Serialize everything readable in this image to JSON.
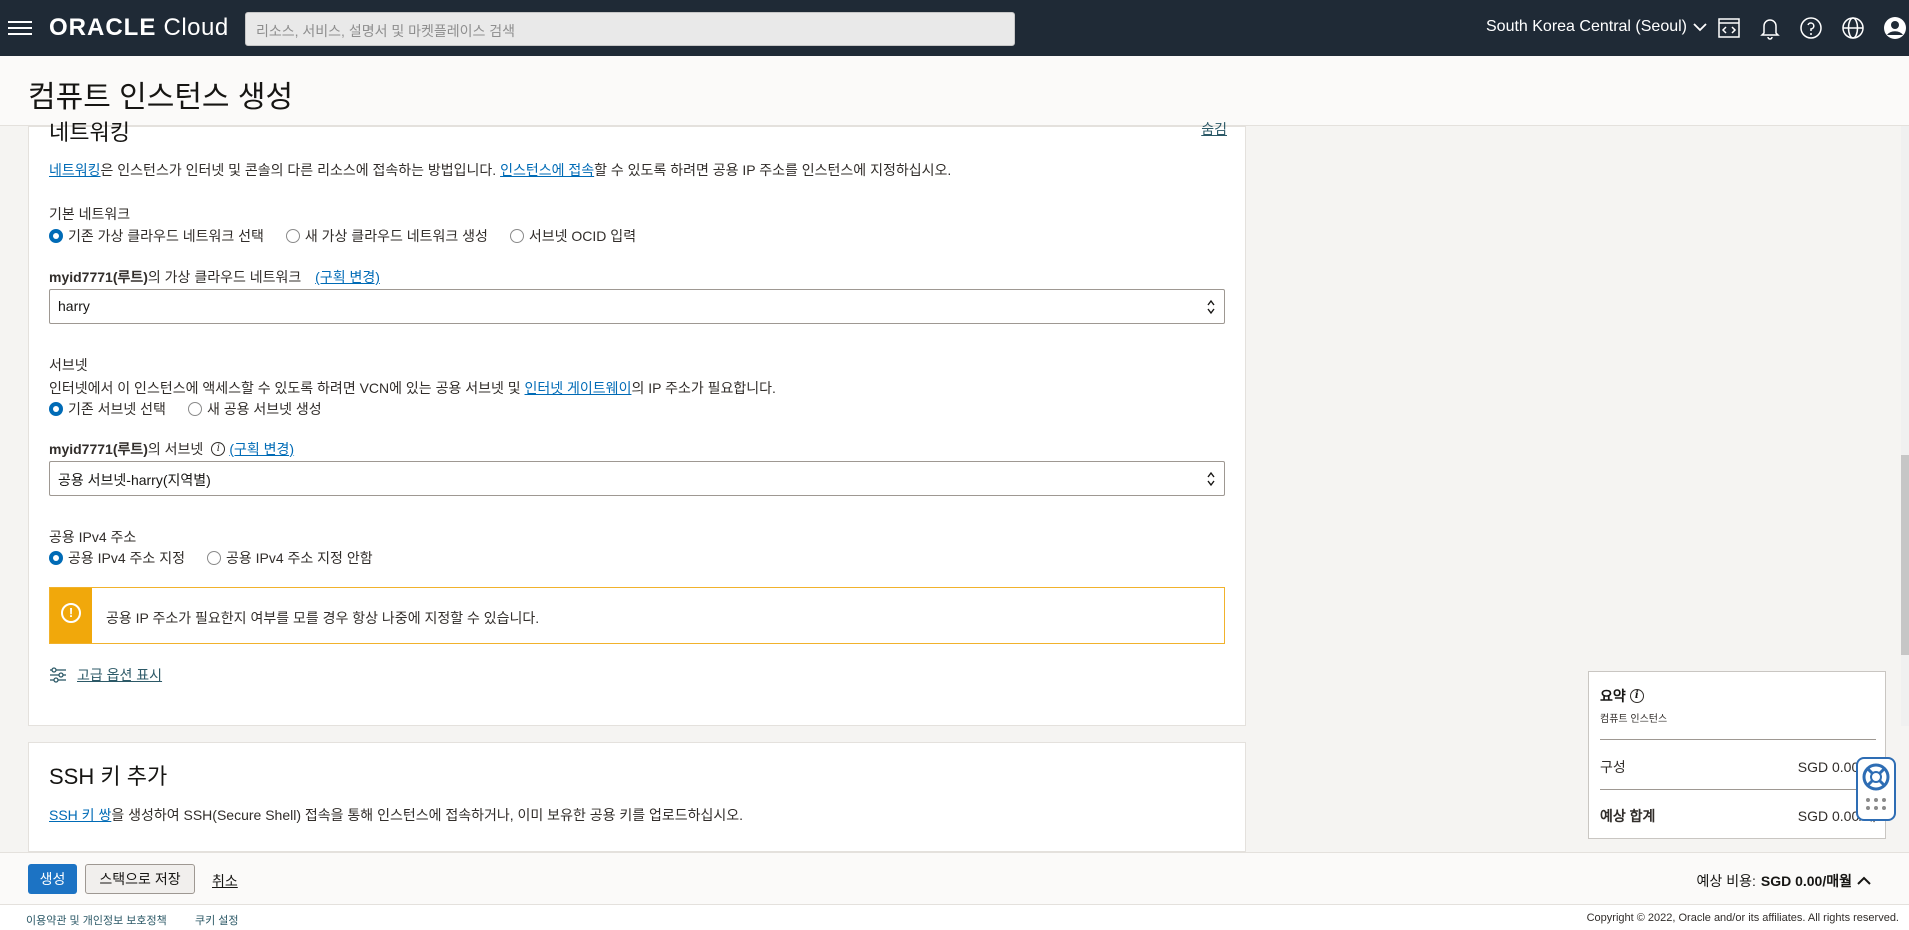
{
  "topbar": {
    "logo_brand": "ORACLE",
    "logo_product": " Cloud",
    "search_placeholder": "리소스, 서비스, 설명서 및 마켓플레이스 검색",
    "region": "South Korea Central (Seoul)",
    "icons": [
      "menu-icon",
      "code-editor-icon",
      "bell-icon",
      "help-icon",
      "globe-icon",
      "user-icon"
    ]
  },
  "page": {
    "title": "컴퓨트 인스턴스 생성"
  },
  "networking": {
    "title": "네트워킹",
    "help_link": "숨김",
    "desc_link1": "네트워킹",
    "desc_part1": "은 인스턴스가 인터넷 및 콘솔의 다른 리소스에 접속하는 방법입니다. ",
    "desc_link2": "인스턴스에 접속",
    "desc_part2": "할 수 있도록 하려면 공용 IP 주소를 인스턴스에 지정하십시오.",
    "primary_network_label": "기본 네트워크",
    "network_options": [
      "기존 가상 클라우드 네트워크 선택",
      "새 가상 클라우드 네트워크 생성",
      "서브넷 OCID 입력"
    ],
    "vcn_compartment": "myid7771(루트)",
    "vcn_label_suffix": "의 가상 클라우드 네트워크",
    "change_compartment": "(구획 변경)",
    "vcn_value": "harry",
    "subnet_label": "서브넷",
    "subnet_desc_part1": "인터넷에서 이 인스턴스에 액세스할 수 있도록 하려면 VCN에 있는 공용 서브넷 및 ",
    "subnet_desc_link": "인터넷 게이트웨이",
    "subnet_desc_part2": "의 IP 주소가 필요합니다.",
    "subnet_options": [
      "기존 서브넷 선택",
      "새 공용 서브넷 생성"
    ],
    "subnet_compartment": "myid7771(루트)",
    "subnet_label_suffix": "의 서브넷",
    "subnet_value": "공용 서브넷-harry(지역별)",
    "ipv4_label": "공용 IPv4 주소",
    "ipv4_options": [
      "공용 IPv4 주소 지정",
      "공용 IPv4 주소 지정 안함"
    ],
    "warning": "공용 IP 주소가 필요한지 여부를 모를 경우 항상 나중에 지정할 수 있습니다.",
    "advanced": "고급 옵션 표시"
  },
  "ssh": {
    "title": "SSH 키 추가",
    "link": "SSH 키 쌍",
    "desc": "을 생성하여 SSH(Secure Shell) 접속을 통해 인스턴스에 접속하거나, 이미 보유한 공용 키를 업로드하십시오."
  },
  "summary": {
    "title": "요약",
    "subtitle": "컴퓨트 인스턴스",
    "rows": [
      {
        "label": "구성",
        "value": "SGD 0.00/매"
      },
      {
        "label": "예상 합계",
        "value": "SGD 0.00/매"
      }
    ]
  },
  "actions": {
    "create": "생성",
    "save_stack": "스택으로 저장",
    "cancel": "취소",
    "estimate_label": "예상 비용: ",
    "estimate_value": "SGD 0.00/매월"
  },
  "footer": {
    "terms": "이용약관 및 개인정보 보호정책",
    "cookies": "쿠키 설정",
    "copyright": "Copyright © 2022, Oracle and/or its affiliates. All rights reserved."
  },
  "colors": {
    "topbar": "#1f2a36",
    "link": "#006bb6",
    "primary": "#1c73c4",
    "warning": "#f1a80b"
  }
}
